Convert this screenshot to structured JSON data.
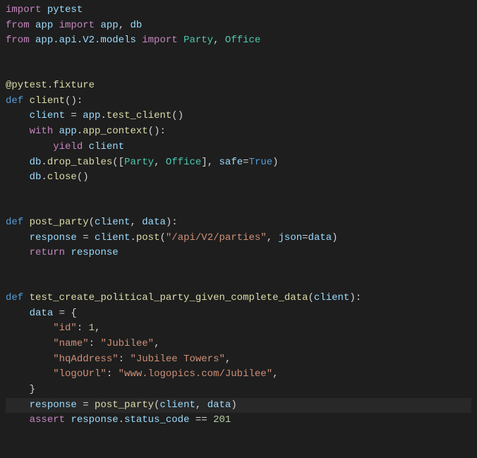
{
  "lines": {
    "l1_import": "import",
    "l1_pytest": "pytest",
    "l2_from": "from",
    "l2_app": "app",
    "l2_import": "import",
    "l2_app2": "app",
    "l2_comma": ", ",
    "l2_db": "db",
    "l3_from": "from",
    "l3_path": "app.api.V2.models",
    "l3_import": "import",
    "l3_party": "Party",
    "l3_comma": ", ",
    "l3_office": "Office",
    "l6_at": "@pytest.fixture",
    "l7_def": "def",
    "l7_fn": "client",
    "l7_parens": "():",
    "l8_client": "client",
    "l8_eq": " = ",
    "l8_app": "app",
    "l8_dot": ".",
    "l8_tc": "test_client",
    "l8_p": "()",
    "l9_with": "with",
    "l9_app": "app",
    "l9_dot": ".",
    "l9_ac": "app_context",
    "l9_p": "():",
    "l10_yield": "yield",
    "l10_client": "client",
    "l11_db": "db",
    "l11_dot": ".",
    "l11_dt": "drop_tables",
    "l11_open": "([",
    "l11_party": "Party",
    "l11_c": ", ",
    "l11_office": "Office",
    "l11_close": "], ",
    "l11_safe": "safe",
    "l11_eq": "=",
    "l11_true": "True",
    "l11_end": ")",
    "l12_db": "db",
    "l12_dot": ".",
    "l12_close": "close",
    "l12_p": "()",
    "l15_def": "def",
    "l15_fn": "post_party",
    "l15_open": "(",
    "l15_client": "client",
    "l15_c": ", ",
    "l15_data": "data",
    "l15_close": "):",
    "l16_resp": "response",
    "l16_eq": " = ",
    "l16_client": "client",
    "l16_dot": ".",
    "l16_post": "post",
    "l16_open": "(",
    "l16_url": "\"/api/V2/parties\"",
    "l16_c": ", ",
    "l16_json": "json",
    "l16_eq2": "=",
    "l16_data": "data",
    "l16_close": ")",
    "l17_return": "return",
    "l17_resp": "response",
    "l20_def": "def",
    "l20_fn": "test_create_political_party_given_complete_data",
    "l20_open": "(",
    "l20_client": "client",
    "l20_close": "):",
    "l21_data": "data",
    "l21_eq": " = {",
    "l22_k": "\"id\"",
    "l22_c": ": ",
    "l22_v": "1",
    "l22_e": ",",
    "l23_k": "\"name\"",
    "l23_c": ": ",
    "l23_v": "\"Jubilee\"",
    "l23_e": ",",
    "l24_k": "\"hqAddress\"",
    "l24_c": ": ",
    "l24_v": "\"Jubilee Towers\"",
    "l24_e": ",",
    "l25_k": "\"logoUrl\"",
    "l25_c": ": ",
    "l25_v": "\"www.logopics.com/Jubilee\"",
    "l25_e": ",",
    "l26_close": "}",
    "l27_resp": "response",
    "l27_eq": " = ",
    "l27_pp": "post_party",
    "l27_open": "(",
    "l27_client": "client",
    "l27_c": ", ",
    "l27_data": "data",
    "l27_close": ")",
    "l28_assert": "assert",
    "l28_resp": "response",
    "l28_dot": ".",
    "l28_sc": "status_code",
    "l28_eq": " == ",
    "l28_201": "201"
  }
}
